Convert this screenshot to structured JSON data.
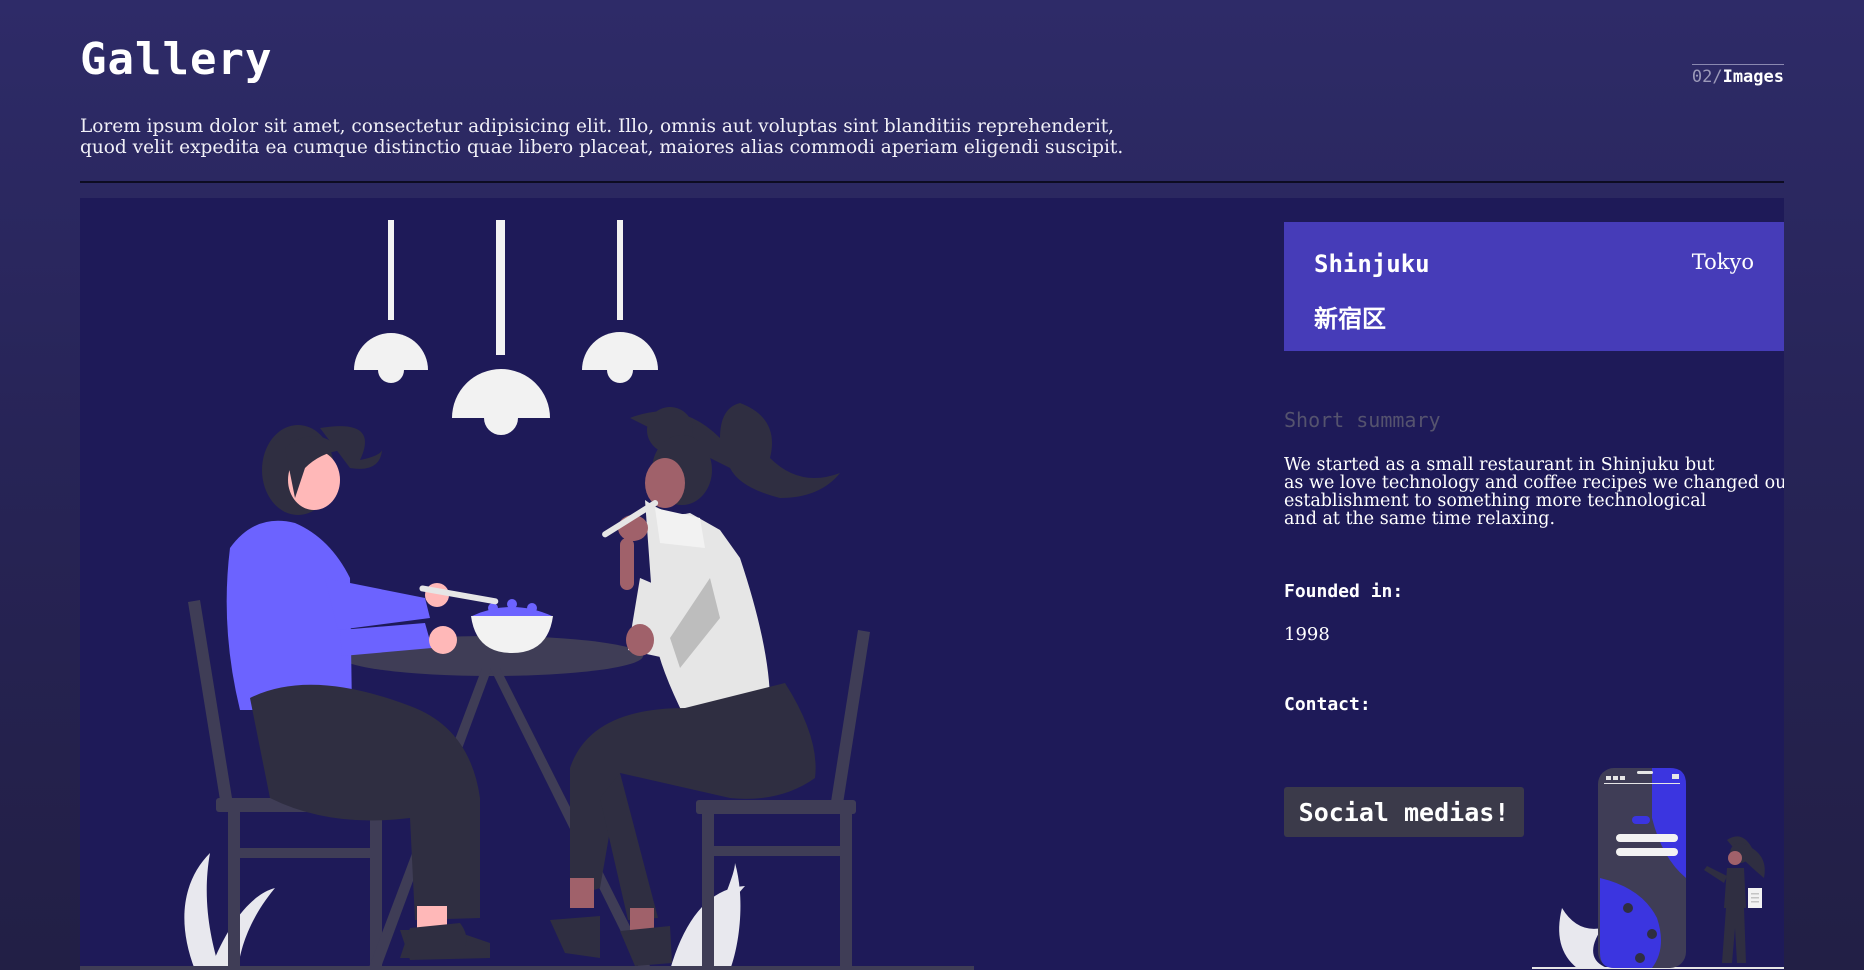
{
  "header": {
    "title": "Gallery",
    "counter_number": "02",
    "counter_separator": "/",
    "counter_label": "Images",
    "intro_line1": "Lorem ipsum dolor sit amet, consectetur adipisicing elit. Illo, omnis aut voluptas sint blanditiis reprehenderit,",
    "intro_line2": "quod velit expedita ea cumque distinctio quae libero placeat, maiores alias commodi aperiam eligendi suscipit."
  },
  "card": {
    "name": "Shinjuku",
    "kanji": "新宿区",
    "city": "Tokyo"
  },
  "summary": {
    "title": "Short summary",
    "lines": [
      "We started as a small restaurant in Shinjuku but",
      "as we love technology and coffee recipes we changed our",
      "establishment to something more technological",
      "and at the same time relaxing."
    ]
  },
  "founded": {
    "label": "Founded in:",
    "value": "1998"
  },
  "contact": {
    "label": "Contact:"
  },
  "social_button": {
    "label": "Social medias!"
  },
  "colors": {
    "background": "#2e2b68",
    "panel": "#1e1a58",
    "card": "#463cb8",
    "accent_blue": "#6c63ff",
    "button": "#3b3a4a"
  },
  "icons": {
    "main_illustration": "dining-couple-illustration",
    "small_illustration": "phone-person-illustration"
  }
}
